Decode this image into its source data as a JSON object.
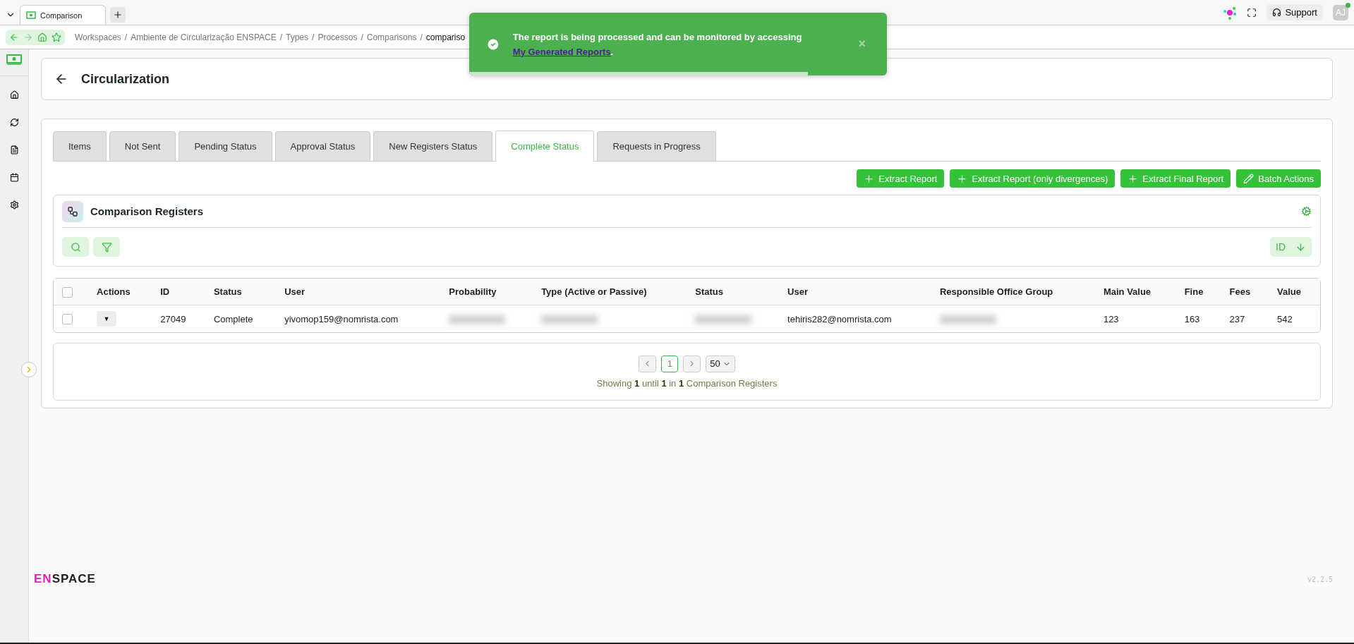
{
  "browser": {
    "tab": {
      "title": "Comparison"
    },
    "breadcrumb": [
      {
        "kind": "link",
        "text": "Workspaces"
      },
      {
        "kind": "separator",
        "text": "/"
      },
      {
        "kind": "link",
        "text": "Ambiente de Circularização ENSPACE"
      },
      {
        "kind": "separator",
        "text": "/"
      },
      {
        "kind": "link",
        "text": "Types"
      },
      {
        "kind": "separator",
        "text": "/"
      },
      {
        "kind": "link",
        "text": "Processos"
      },
      {
        "kind": "separator",
        "text": "/"
      },
      {
        "kind": "link",
        "text": "Comparisons"
      },
      {
        "kind": "separator",
        "text": "/"
      },
      {
        "kind": "current",
        "text": "compariso"
      }
    ],
    "support": "Support",
    "avatar": "AJ"
  },
  "toast": {
    "message": "The report is being processed and can be monitored by accessing ",
    "link": "My Generated Reports",
    "end": ".",
    "close": "×",
    "level": 0.81
  },
  "sidebar": {
    "items": [
      {
        "kind": "home"
      },
      {
        "kind": "refresh"
      },
      {
        "kind": "document"
      },
      {
        "kind": "calendar"
      },
      {
        "kind": "settings"
      }
    ]
  },
  "page": {
    "title": "Circularization"
  },
  "tabs": [
    {
      "label": "Items",
      "selected": false
    },
    {
      "label": "Not Sent",
      "selected": false
    },
    {
      "label": "Pending Status",
      "selected": false
    },
    {
      "label": "Approval Status",
      "selected": false
    },
    {
      "label": "New Registers Status",
      "selected": false
    },
    {
      "label": "Complete Status",
      "selected": true
    },
    {
      "label": "Requests in Progress",
      "selected": false
    }
  ],
  "actions": [
    {
      "label": "Extract Report",
      "kind": "plus"
    },
    {
      "label": "Extract Report (only divergences)",
      "kind": "plus"
    },
    {
      "label": "Extract Final Report",
      "kind": "plus"
    },
    {
      "label": "Batch Actions",
      "kind": "pencil"
    }
  ],
  "registers": {
    "title": "Comparison Registers",
    "sort": "ID"
  },
  "table": {
    "columns": [
      "Actions",
      "ID",
      "Status",
      "User",
      "Probability",
      "Type (Active or Passive)",
      "Status",
      "User",
      "Responsible Office Group",
      "Main Value",
      "Fine",
      "Fees",
      "Value"
    ],
    "select_all": {
      "checked": false
    },
    "rows": [
      {
        "checked": false,
        "cells": [
          "▼",
          "27049",
          "Complete",
          "yivomop159@nomrista.com",
          null,
          null,
          null,
          "tehiris282@nomrista.com",
          null,
          "123",
          "163",
          "237",
          "542"
        ]
      }
    ]
  },
  "pagination": {
    "page": "1",
    "page_size": "50",
    "summary": "Showing **1** until **1** in **1** Comparison Registers"
  },
  "footer": {
    "logo_a": "EN",
    "logo_b": "SPACE",
    "version": "v2.2.5"
  }
}
